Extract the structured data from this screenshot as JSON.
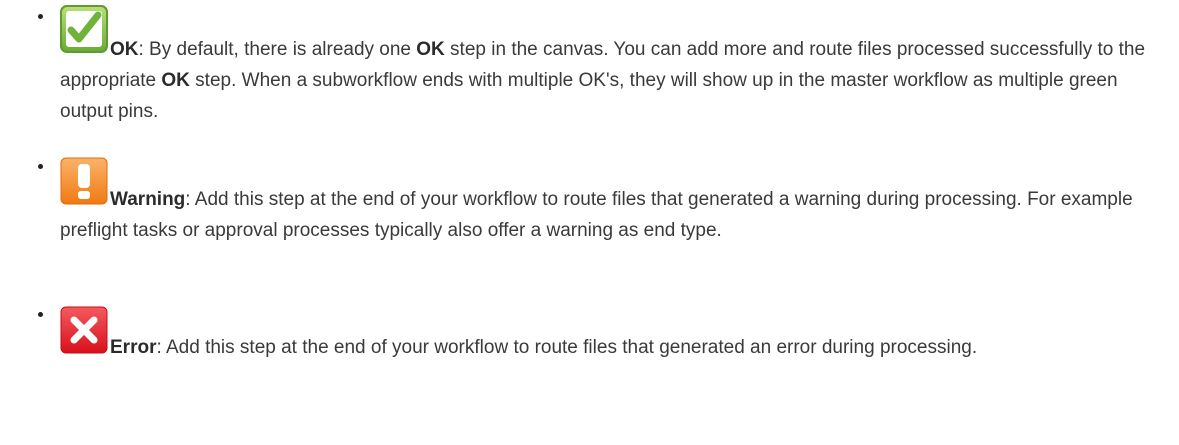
{
  "items": [
    {
      "icon": "green-check-icon",
      "label": "OK",
      "text_a": ": By default, there is already one ",
      "inline_label": "OK",
      "text_b": " step in the canvas. You can add more and route files processed successfully to the appropriate ",
      "inline_label_2": "OK",
      "text_c": " step. When a subworkflow ends with multiple OK's, they will show up in the master workflow as multiple green output pins."
    },
    {
      "icon": "orange-warning-icon",
      "label": "Warning",
      "text_a": ": Add this step at the end of your workflow to route files that generated a warning during processing. For example preflight tasks or approval processes typically also offer a warning as end type."
    },
    {
      "icon": "red-x-icon",
      "label": "Error",
      "text_a": ": Add this step at the end of your workflow to route files that generated an error during processing."
    }
  ],
  "colors": {
    "ok_green": "#7ac142",
    "warning_orange": "#f58220",
    "error_red": "#e8202a",
    "text": "#3a3a3a"
  }
}
